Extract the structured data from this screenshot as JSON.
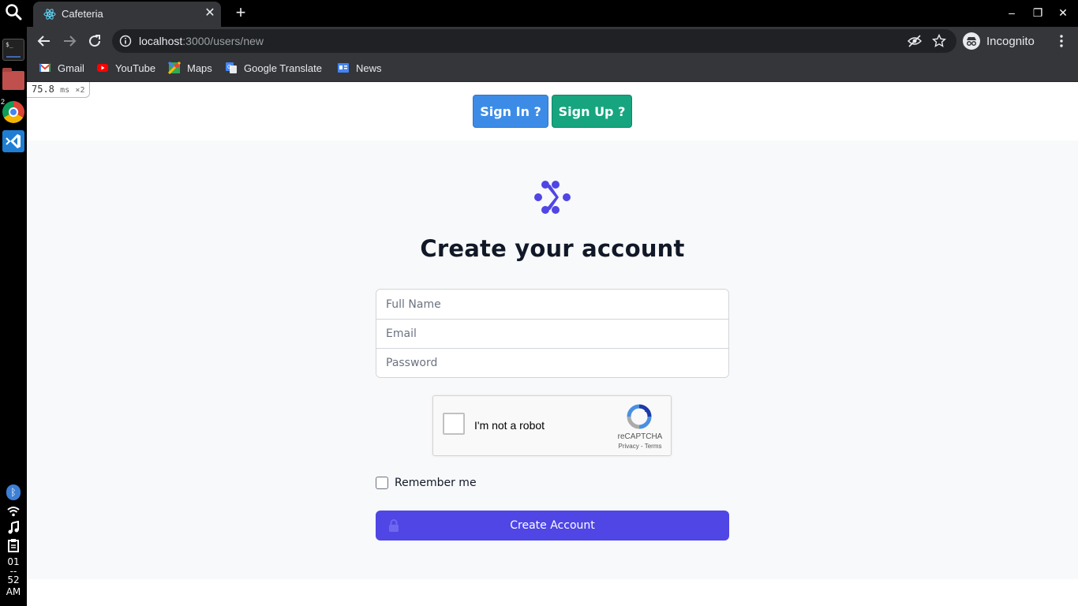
{
  "dock": {
    "terminal_glyph": "$_",
    "chrome_badge": "2",
    "clock_lines": [
      "01",
      "--",
      "52",
      "AM"
    ]
  },
  "browser": {
    "tab_title": "Cafeteria",
    "url_host": "localhost",
    "url_rest": ":3000/users/new",
    "incognito_label": "Incognito",
    "bookmarks": [
      {
        "label": "Gmail",
        "icon": "gmail-icon"
      },
      {
        "label": "YouTube",
        "icon": "youtube-icon"
      },
      {
        "label": "Maps",
        "icon": "maps-icon"
      },
      {
        "label": "Google Translate",
        "icon": "translate-icon"
      },
      {
        "label": "News",
        "icon": "news-icon"
      }
    ]
  },
  "perf": {
    "value": "75.8",
    "unit": "ms",
    "multiplier": "×2"
  },
  "header": {
    "signin_label": "Sign In ?",
    "signup_label": "Sign Up ?"
  },
  "form": {
    "title": "Create your account",
    "fullname_placeholder": "Full Name",
    "email_placeholder": "Email",
    "password_placeholder": "Password",
    "captcha_label": "I'm not a robot",
    "captcha_brand": "reCAPTCHA",
    "captcha_links": "Privacy - Terms",
    "remember_label": "Remember me",
    "submit_label": "Create Account"
  },
  "colors": {
    "accent": "#4f46e5",
    "signin": "#3c8ce7",
    "signup": "#16a57f",
    "panel_bg": "#f8f9fa"
  }
}
